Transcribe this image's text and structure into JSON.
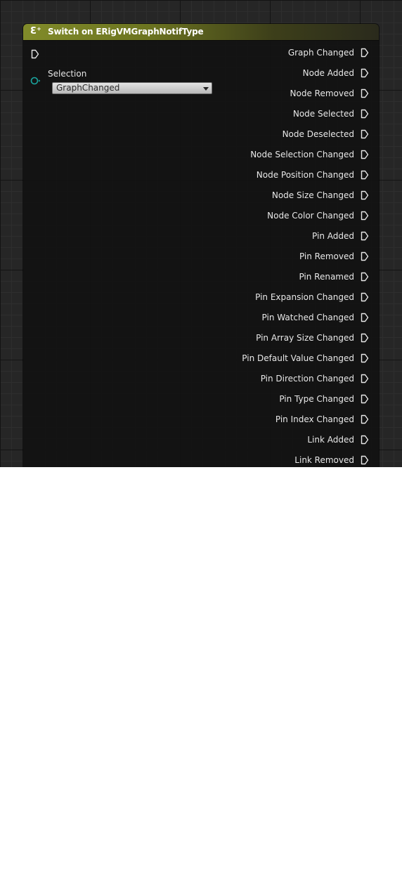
{
  "node": {
    "title": "Switch on ERigVMGraphNotifType",
    "icon": "enum-switch-icon",
    "header_color": "#818b2a"
  },
  "inputs": {
    "selection_label": "Selection",
    "selection_value": "GraphChanged",
    "selection_pin_color": "#1aa7a1"
  },
  "outputs": [
    {
      "label": "Graph Changed"
    },
    {
      "label": "Node Added"
    },
    {
      "label": "Node Removed"
    },
    {
      "label": "Node Selected"
    },
    {
      "label": "Node Deselected"
    },
    {
      "label": "Node Selection Changed"
    },
    {
      "label": "Node Position Changed"
    },
    {
      "label": "Node Size Changed"
    },
    {
      "label": "Node Color Changed"
    },
    {
      "label": "Pin Added"
    },
    {
      "label": "Pin Removed"
    },
    {
      "label": "Pin Renamed"
    },
    {
      "label": "Pin Expansion Changed"
    },
    {
      "label": "Pin Watched Changed"
    },
    {
      "label": "Pin Array Size Changed"
    },
    {
      "label": "Pin Default Value Changed"
    },
    {
      "label": "Pin Direction Changed"
    },
    {
      "label": "Pin Type Changed"
    },
    {
      "label": "Pin Index Changed"
    },
    {
      "label": "Link Added"
    },
    {
      "label": "Link Removed"
    }
  ]
}
